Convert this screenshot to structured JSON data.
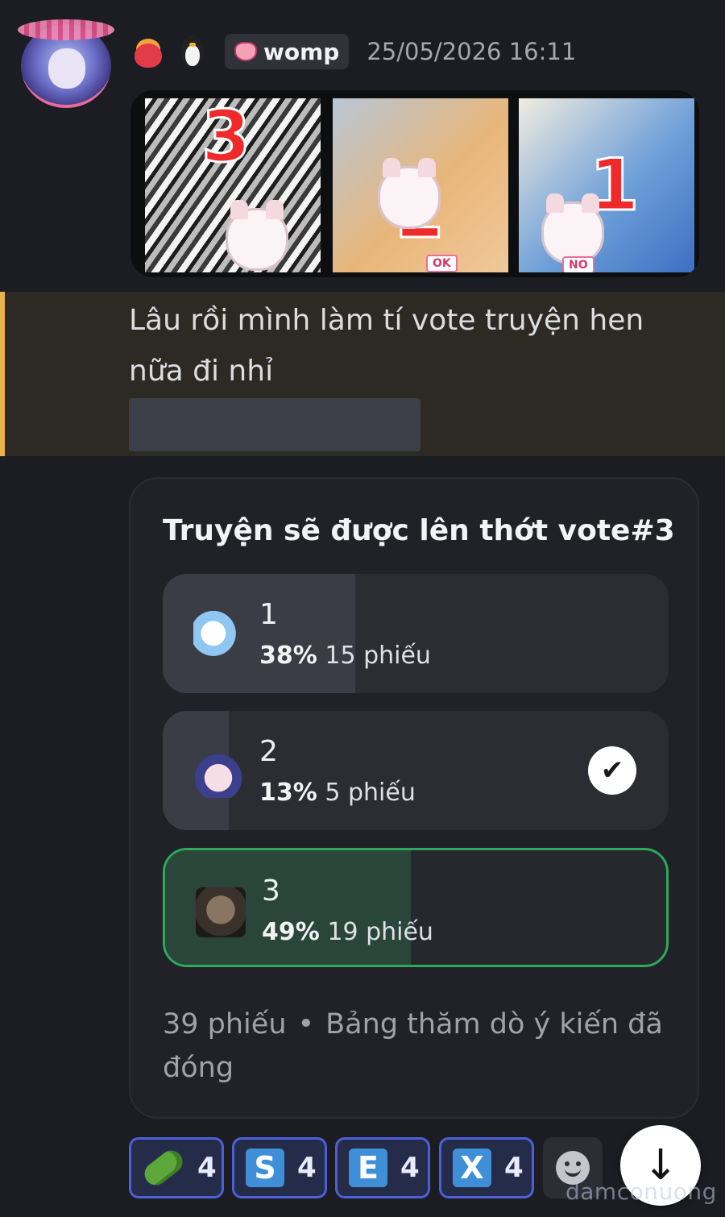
{
  "message": {
    "author_tag": "womp",
    "timestamp": "25/05/2026 16:11",
    "text": "Lâu rồi mình làm tí vote truyện hen nữa đi nhỉ",
    "images": [
      {
        "number": "3",
        "sign": ""
      },
      {
        "number": "2",
        "sign": "OK"
      },
      {
        "number": "1",
        "sign": "NO"
      }
    ]
  },
  "poll": {
    "question": "Truyện sẽ được lên thớt vote#3",
    "answers": [
      {
        "label": "1",
        "percent": "38%",
        "votes": "15 phiếu",
        "fill_fraction": 0.38,
        "selected": false,
        "winner": false
      },
      {
        "label": "2",
        "percent": "13%",
        "votes": "5 phiếu",
        "fill_fraction": 0.13,
        "selected": true,
        "winner": false
      },
      {
        "label": "3",
        "percent": "49%",
        "votes": "19 phiếu",
        "fill_fraction": 0.49,
        "selected": false,
        "winner": true
      }
    ],
    "total_votes": "39 phiếu",
    "separator": "•",
    "status": "Bảng thăm dò ý kiến đã đóng"
  },
  "reactions": [
    {
      "icon": "cucumber-icon",
      "glyph": "",
      "count": "4"
    },
    {
      "icon": "letter-s-icon",
      "glyph": "S",
      "count": "4"
    },
    {
      "icon": "letter-e-icon",
      "glyph": "E",
      "count": "4"
    },
    {
      "icon": "letter-x-icon",
      "glyph": "X",
      "count": "4"
    }
  ],
  "controls": {
    "scroll_down_glyph": "↓",
    "check_glyph": "✔"
  },
  "watermark": "damconuong",
  "colors": {
    "highlight_bar": "#e9b14a",
    "winner_border": "#2ea85a",
    "reaction_border": "#4d5fd6"
  }
}
